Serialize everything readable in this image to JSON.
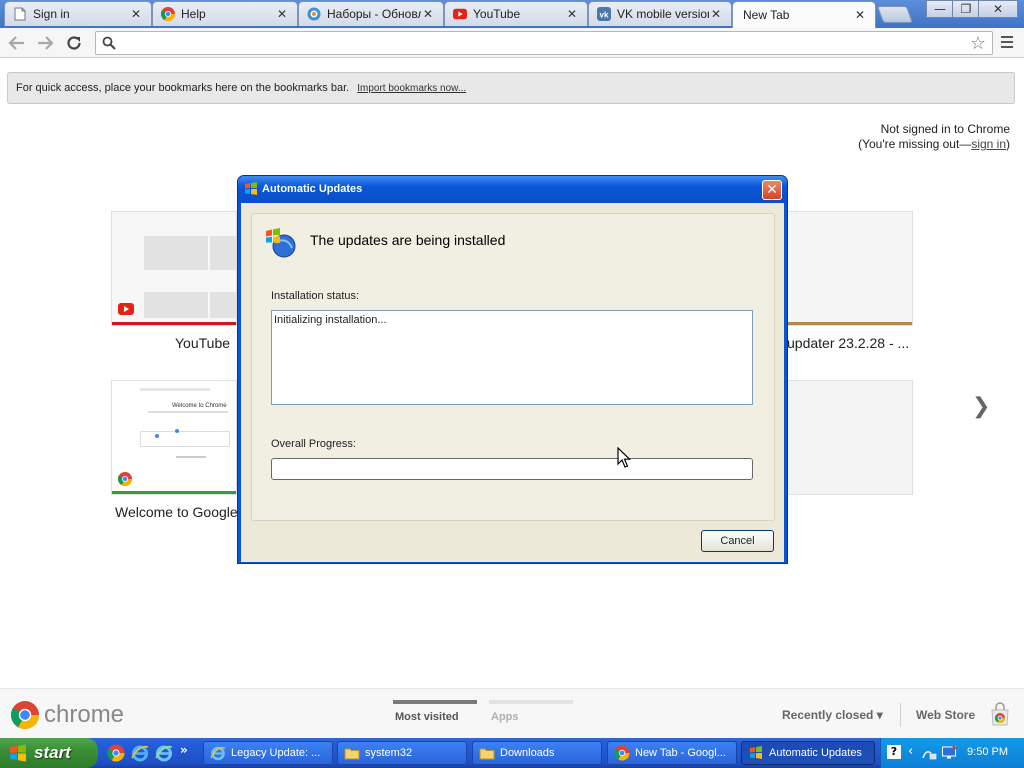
{
  "browser": {
    "tabs": [
      {
        "title": "Sign in",
        "icon": "page-icon"
      },
      {
        "title": "Help",
        "icon": "chrome-icon"
      },
      {
        "title": "Наборы - Обновл",
        "icon": "site-icon"
      },
      {
        "title": "YouTube",
        "icon": "youtube-icon"
      },
      {
        "title": "VK mobile version",
        "icon": "vk-icon"
      },
      {
        "title": "New Tab",
        "icon": ""
      }
    ],
    "close_glyph": "✕",
    "window_buttons": {
      "minimize": "—",
      "restore": "❐",
      "close": "✕"
    },
    "omnibox_value": "",
    "menu_icon": "hamburger-icon"
  },
  "bookmarks_bar": {
    "message": "For quick access, place your bookmarks here on the bookmarks bar.",
    "import_link": "Import bookmarks now..."
  },
  "signin": {
    "line1": "Not signed in to Chrome",
    "line2_prefix": "(You're missing out—",
    "link": "sign in",
    "line2_suffix": ")"
  },
  "thumbnails": [
    {
      "label": "YouTube",
      "bar_color": "#cc181e"
    },
    {
      "label": "updater 23.2.28 - ...",
      "bar_color": "#b08a4a"
    },
    {
      "label": "Welcome to Google",
      "bar_color": "#3a9a3a"
    },
    {
      "label": "",
      "bar_color": ""
    }
  ],
  "thumbnail_welcome_text": "Welcome to Chrome",
  "next_arrow": "❯",
  "bottom_bar": {
    "logo_text": "chrome",
    "tabs": [
      {
        "label": "Most visited",
        "active": true
      },
      {
        "label": "Apps",
        "active": false
      }
    ],
    "recently_closed": "Recently closed ▾",
    "web_store": "Web Store"
  },
  "dialog": {
    "title": "Automatic Updates",
    "close_glyph": "✕",
    "heading": "The updates are being installed",
    "status_label": "Installation status:",
    "status_text": "Initializing installation...",
    "progress_label": "Overall Progress:",
    "progress_percent": 0,
    "cancel_label": "Cancel"
  },
  "taskbar": {
    "start_label": "start",
    "quick_launch": [
      "chrome-icon",
      "ie-icon",
      "ie-alt-icon"
    ],
    "overflow": "»",
    "tasks": [
      {
        "label": "Legacy Update: ...",
        "icon": "ie-icon",
        "active": false
      },
      {
        "label": "system32",
        "icon": "folder-icon",
        "active": false
      },
      {
        "label": "Downloads",
        "icon": "folder-icon",
        "active": false
      },
      {
        "label": "New Tab - Googl...",
        "icon": "chrome-icon",
        "active": false
      },
      {
        "label": "Automatic Updates",
        "icon": "windows-update-icon",
        "active": true
      }
    ],
    "clock": "9:50 PM"
  },
  "colors": {
    "xp_title": "#0b57d3",
    "progress_green": "#2bd12b",
    "youtube_red": "#cc181e"
  }
}
